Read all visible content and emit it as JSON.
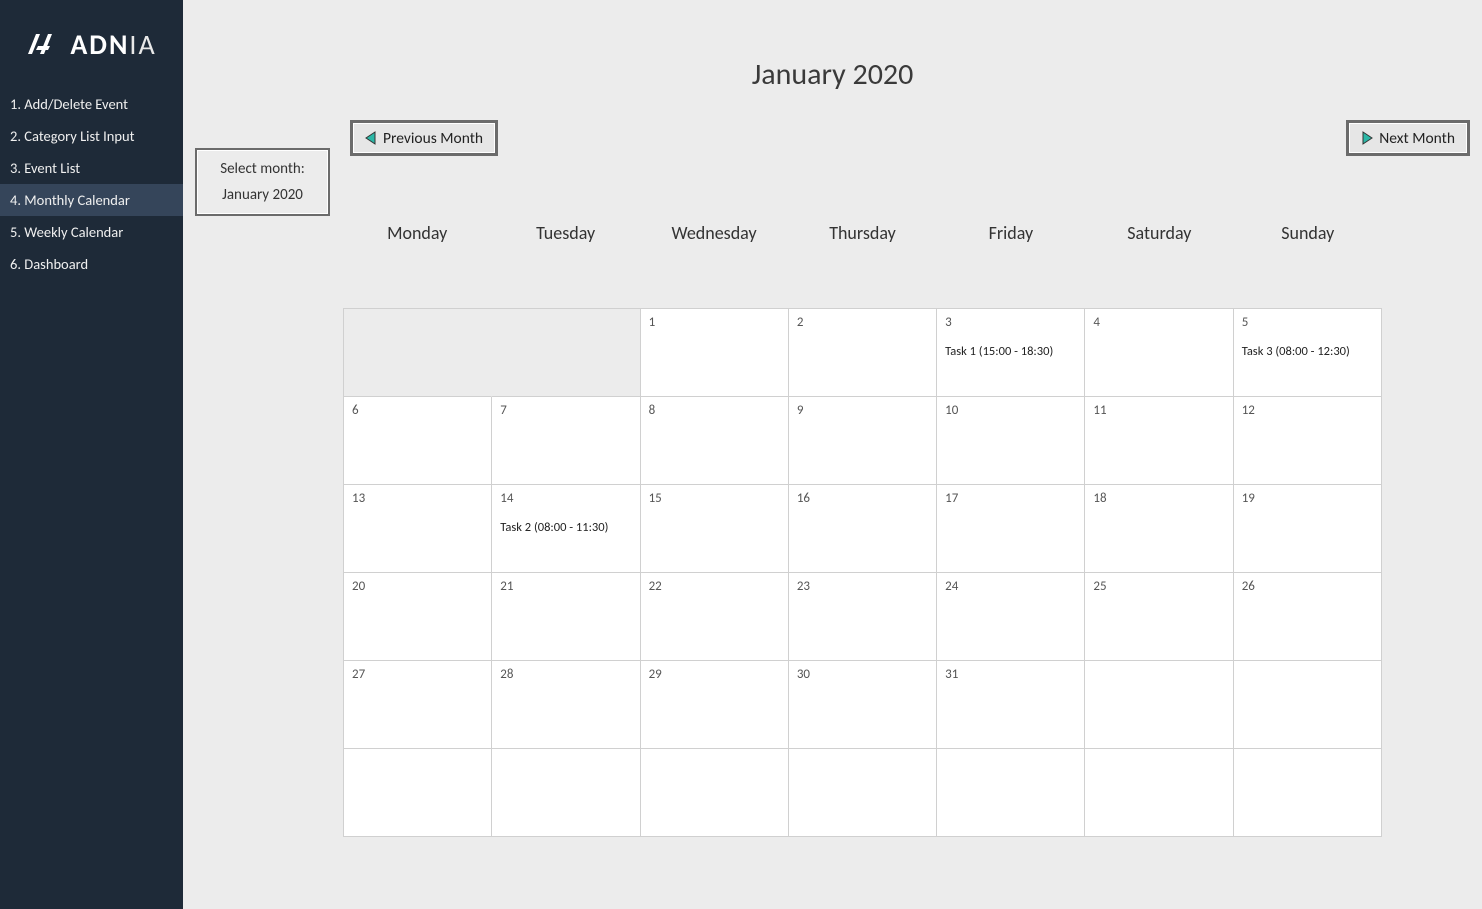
{
  "brand": {
    "bold": "ADN",
    "light": "IA"
  },
  "sidebar": {
    "items": [
      {
        "label": "1. Add/Delete Event",
        "active": false
      },
      {
        "label": "2. Category List Input",
        "active": false
      },
      {
        "label": "3. Event List",
        "active": false
      },
      {
        "label": "4. Monthly Calendar",
        "active": true
      },
      {
        "label": "5. Weekly Calendar",
        "active": false
      },
      {
        "label": "6. Dashboard",
        "active": false
      }
    ]
  },
  "header": {
    "title": "January 2020",
    "select_month_label": "Select month:",
    "select_month_value": "January 2020",
    "prev_button_label": "Previous Month",
    "next_button_label": "Next Month"
  },
  "weekdays": [
    "Monday",
    "Tuesday",
    "Wednesday",
    "Thursday",
    "Friday",
    "Saturday",
    "Sunday"
  ],
  "grid_rows": [
    [
      {
        "day": "",
        "event": ""
      },
      {
        "day": "",
        "event": ""
      },
      {
        "day": "1",
        "event": ""
      },
      {
        "day": "2",
        "event": ""
      },
      {
        "day": "3",
        "event": "Task 1 (15:00 - 18:30)"
      },
      {
        "day": "4",
        "event": ""
      },
      {
        "day": "5",
        "event": "Task 3 (08:00 - 12:30)"
      }
    ],
    [
      {
        "day": "6",
        "event": ""
      },
      {
        "day": "7",
        "event": ""
      },
      {
        "day": "8",
        "event": ""
      },
      {
        "day": "9",
        "event": ""
      },
      {
        "day": "10",
        "event": ""
      },
      {
        "day": "11",
        "event": ""
      },
      {
        "day": "12",
        "event": ""
      }
    ],
    [
      {
        "day": "13",
        "event": ""
      },
      {
        "day": "14",
        "event": "Task 2 (08:00 - 11:30)"
      },
      {
        "day": "15",
        "event": ""
      },
      {
        "day": "16",
        "event": ""
      },
      {
        "day": "17",
        "event": ""
      },
      {
        "day": "18",
        "event": ""
      },
      {
        "day": "19",
        "event": ""
      }
    ],
    [
      {
        "day": "20",
        "event": ""
      },
      {
        "day": "21",
        "event": ""
      },
      {
        "day": "22",
        "event": ""
      },
      {
        "day": "23",
        "event": ""
      },
      {
        "day": "24",
        "event": ""
      },
      {
        "day": "25",
        "event": ""
      },
      {
        "day": "26",
        "event": ""
      }
    ],
    [
      {
        "day": "27",
        "event": ""
      },
      {
        "day": "28",
        "event": ""
      },
      {
        "day": "29",
        "event": ""
      },
      {
        "day": "30",
        "event": ""
      },
      {
        "day": "31",
        "event": ""
      },
      {
        "day": "",
        "event": ""
      },
      {
        "day": "",
        "event": ""
      }
    ],
    [
      {
        "day": "",
        "event": ""
      },
      {
        "day": "",
        "event": ""
      },
      {
        "day": "",
        "event": ""
      },
      {
        "day": "",
        "event": ""
      },
      {
        "day": "",
        "event": ""
      },
      {
        "day": "",
        "event": ""
      },
      {
        "day": "",
        "event": ""
      }
    ]
  ]
}
